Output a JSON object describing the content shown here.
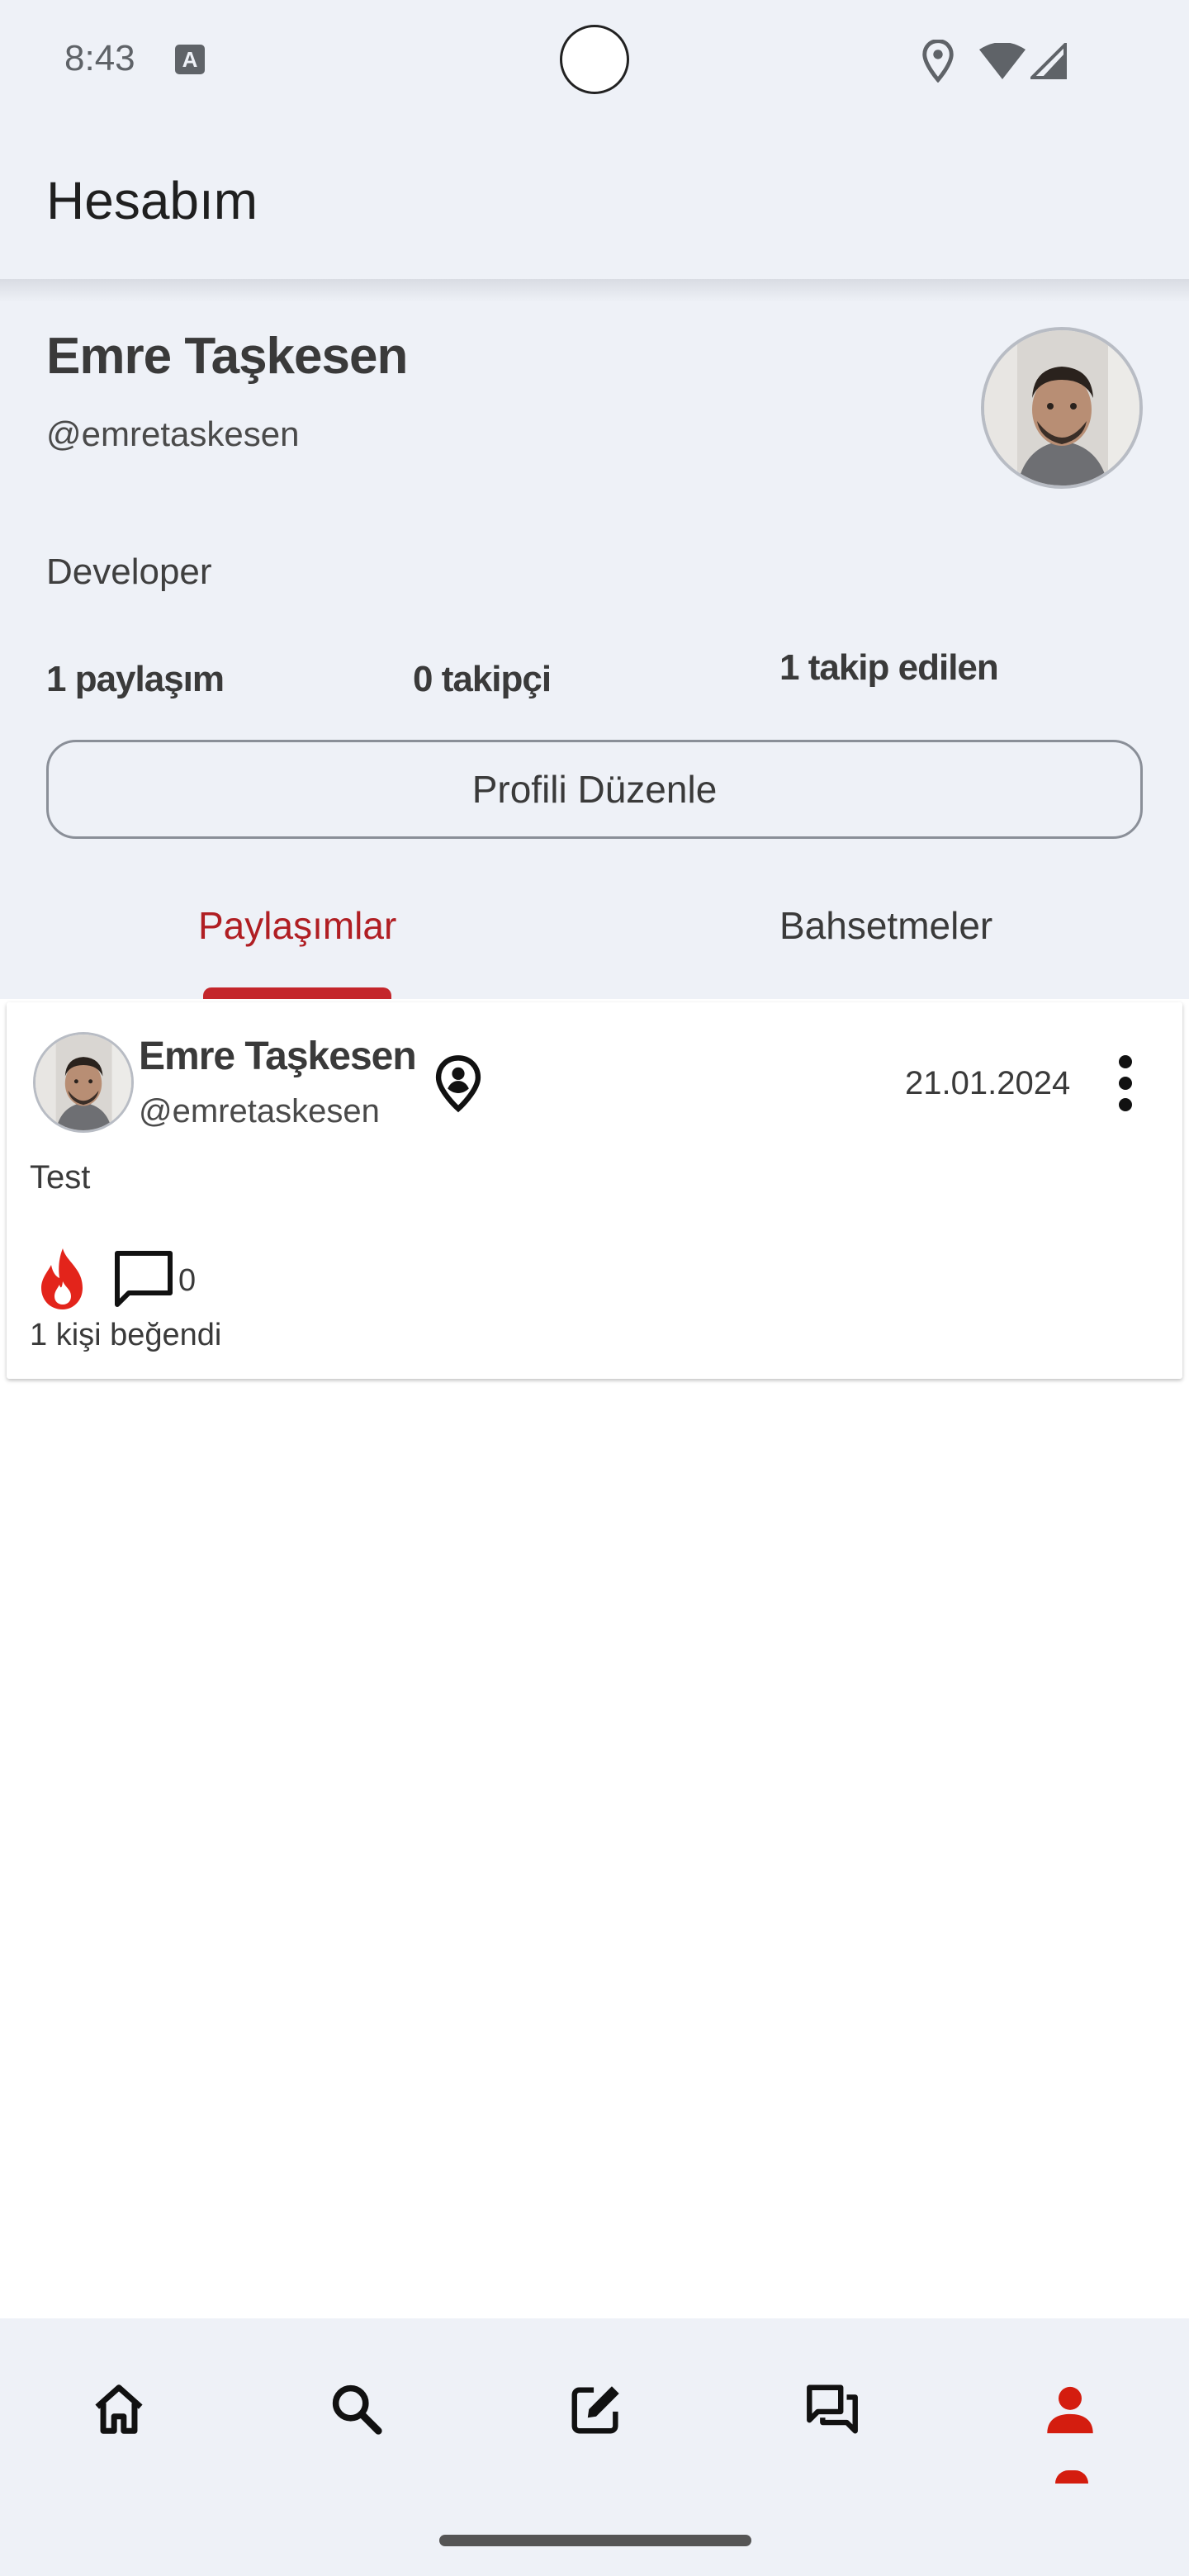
{
  "status_bar": {
    "time": "8:43",
    "notification_icon": "A",
    "icons": [
      "location-icon",
      "wifi-icon",
      "signal-icon"
    ]
  },
  "app_bar": {
    "title": "Hesabım"
  },
  "profile": {
    "name": "Emre Taşkesen",
    "handle": "@emretaskesen",
    "bio": "Developer",
    "stats": {
      "posts": "1 paylaşım",
      "followers": "0 takipçi",
      "following": "1 takip edilen"
    },
    "edit_button_label": "Profili Düzenle"
  },
  "tabs": [
    {
      "label": "Paylaşımlar",
      "active": true
    },
    {
      "label": "Bahsetmeler",
      "active": false
    }
  ],
  "posts": [
    {
      "author": "Emre Taşkesen",
      "handle": "@emretaskesen",
      "date": "21.01.2024",
      "text": "Test",
      "comment_count": "0",
      "likes_text": "1 kişi beğendi"
    }
  ],
  "bottom_nav": {
    "items": [
      "home-icon",
      "search-icon",
      "compose-icon",
      "messages-icon",
      "profile-icon"
    ],
    "active": "profile-icon"
  },
  "colors": {
    "accent": "#b01e23",
    "fire": "#e3241b",
    "background": "#eef1f7"
  }
}
